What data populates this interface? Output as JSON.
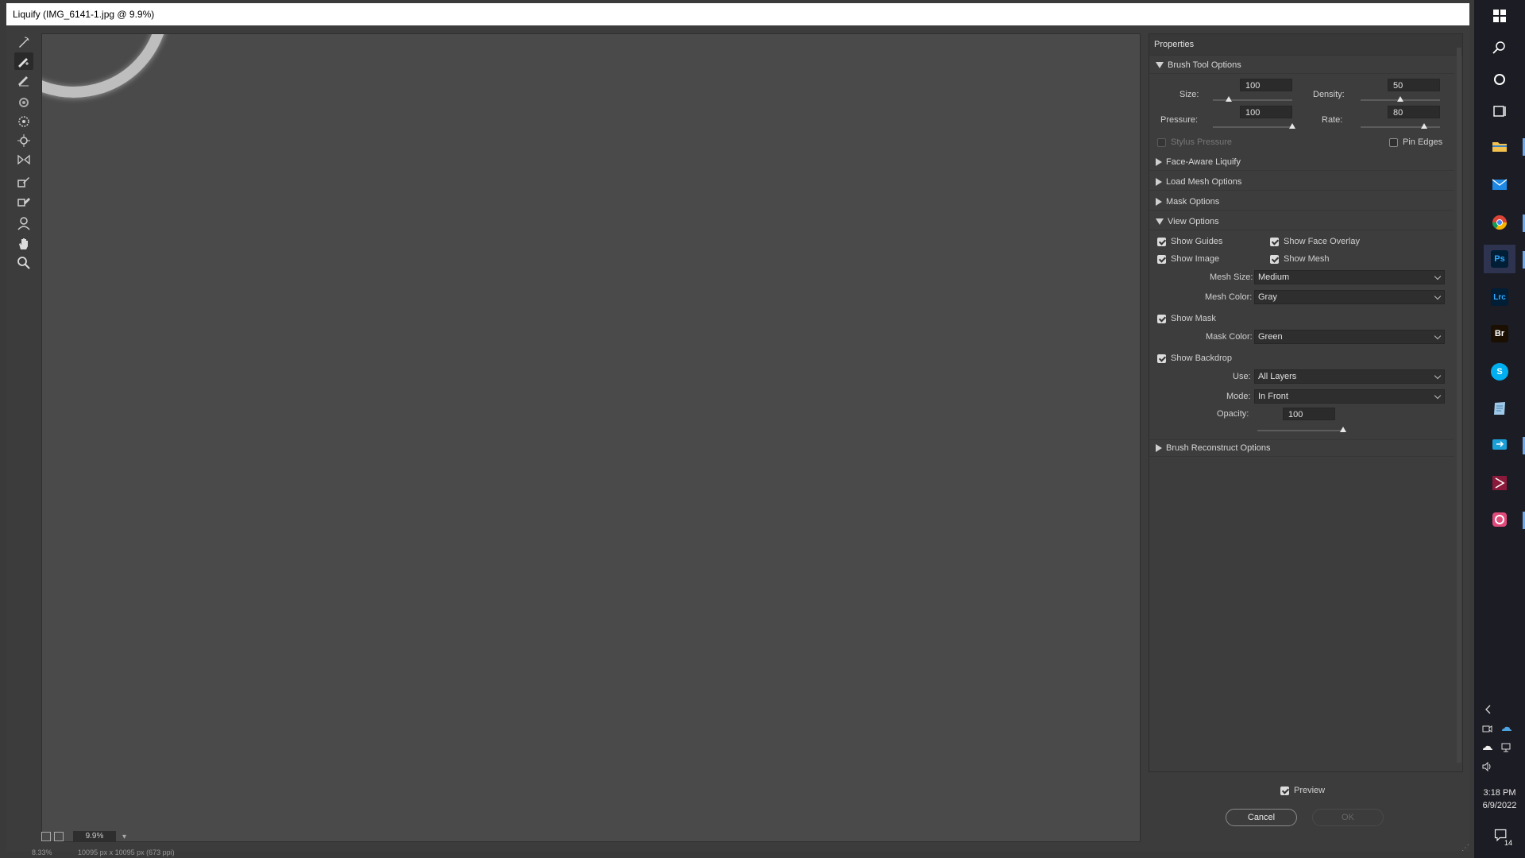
{
  "window": {
    "title": "Liquify (IMG_6141-1.jpg @ 9.9%)"
  },
  "toolbar": {
    "tools": [
      {
        "name": "forward-warp-tool-icon"
      },
      {
        "name": "reconstruct-tool-icon",
        "active": true
      },
      {
        "name": "smooth-tool-icon"
      },
      {
        "name": "twirl-clockwise-tool-icon"
      },
      {
        "name": "pucker-tool-icon"
      },
      {
        "name": "bloat-tool-icon"
      },
      {
        "name": "push-left-tool-icon"
      },
      {
        "name": "freeze-mask-tool-icon"
      },
      {
        "name": "thaw-mask-tool-icon"
      },
      {
        "name": "face-tool-icon"
      },
      {
        "name": "hand-tool-icon"
      },
      {
        "name": "zoom-tool-icon"
      }
    ]
  },
  "canvas": {
    "zoom": "9.9%"
  },
  "statusbar": {
    "zoom": "8.33%",
    "dimensions": "10095 px x 10095 px (673 ppi)"
  },
  "properties": {
    "title": "Properties",
    "brush_tool_options": {
      "heading": "Brush Tool Options",
      "size_label": "Size:",
      "size": "100",
      "size_level": 0.2,
      "density_label": "Density:",
      "density": "50",
      "density_level": 0.5,
      "pressure_label": "Pressure:",
      "pressure": "100",
      "pressure_level": 1.0,
      "rate_label": "Rate:",
      "rate": "80",
      "rate_level": 0.8,
      "stylus_pressure": "Stylus Pressure",
      "pin_edges": "Pin Edges"
    },
    "face_aware": "Face-Aware Liquify",
    "load_mesh": "Load Mesh Options",
    "mask_options": "Mask Options",
    "view_options": {
      "heading": "View Options",
      "show_guides": "Show Guides",
      "show_face_overlay": "Show Face Overlay",
      "show_image": "Show Image",
      "show_mesh": "Show Mesh",
      "mesh_size_label": "Mesh Size:",
      "mesh_size": "Medium",
      "mesh_color_label": "Mesh Color:",
      "mesh_color": "Gray",
      "show_mask": "Show Mask",
      "mask_color_label": "Mask Color:",
      "mask_color": "Green",
      "show_backdrop": "Show Backdrop",
      "use_label": "Use:",
      "use": "All Layers",
      "mode_label": "Mode:",
      "mode": "In Front",
      "opacity_label": "Opacity:",
      "opacity": "100",
      "opacity_level": 1.0
    },
    "brush_reconstruct": "Brush Reconstruct Options"
  },
  "footer": {
    "preview": "Preview",
    "cancel": "Cancel",
    "ok": "OK"
  },
  "taskbar": {
    "time": "3:18 PM",
    "date": "6/9/2022",
    "notifications": "14",
    "apps": [
      {
        "name": "windows-start-icon"
      },
      {
        "name": "search-icon"
      },
      {
        "name": "cortana-icon"
      },
      {
        "name": "task-view-icon"
      },
      {
        "name": "file-explorer-icon"
      },
      {
        "name": "mail-icon"
      },
      {
        "name": "chrome-icon"
      },
      {
        "name": "photoshop-icon",
        "label": "Ps"
      },
      {
        "name": "lightroom-classic-icon",
        "label": "Lrc"
      },
      {
        "name": "bridge-icon",
        "label": "Br"
      },
      {
        "name": "skype-icon",
        "label": "S"
      },
      {
        "name": "notepad-icon"
      },
      {
        "name": "remote-desktop-icon"
      },
      {
        "name": "pdf-app-icon"
      },
      {
        "name": "creative-cloud-icon"
      }
    ]
  },
  "colors": {
    "canvas": "#4a4a4a",
    "panel": "#3d3d3d",
    "taskbar": "#1c1c24",
    "accent": "#6ea8e8"
  }
}
